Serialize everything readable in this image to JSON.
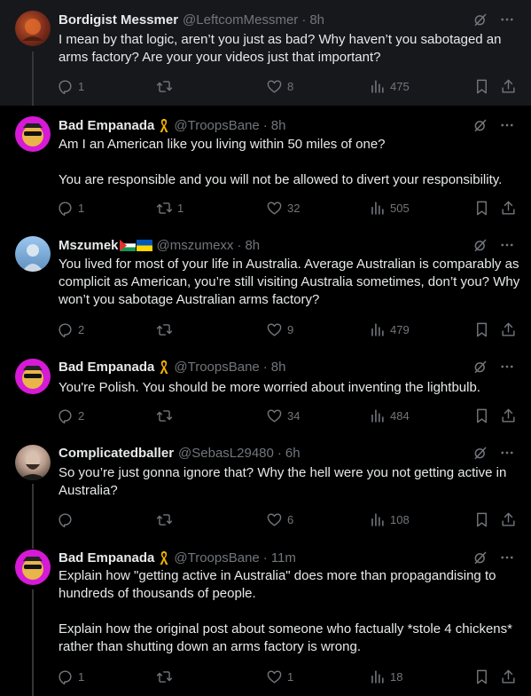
{
  "tweets": [
    {
      "name": "Bordigist Messmer",
      "handle": "@LeftcomMessmer",
      "time": "8h",
      "text": "I mean by that logic, aren’t you just as bad? Why haven’t you sabotaged an arms factory? Are your your videos just that important?",
      "replies": "1",
      "retweets": "",
      "likes": "8",
      "views": "475",
      "avatar": "orange-crest"
    },
    {
      "name": "Bad Empanada",
      "handle": "@TroopsBane",
      "time": "8h",
      "text": "Am I an American like you living within 50 miles of one?\n\nYou are responsible and you will not be allowed to divert your responsibility.",
      "replies": "1",
      "retweets": "1",
      "likes": "32",
      "views": "505",
      "avatar": "empanada"
    },
    {
      "name": "Mszumek",
      "handle": "@mszumexx",
      "time": "8h",
      "text": "You lived for most of your life in Australia. Average Australian is comparably as complicit as American, you’re still visiting Australia sometimes, don’t you? Why won’t you sabotage Australian arms factory?",
      "replies": "2",
      "retweets": "",
      "likes": "9",
      "views": "479",
      "avatar": "statue"
    },
    {
      "name": "Bad Empanada",
      "handle": "@TroopsBane",
      "time": "8h",
      "text": "You're Polish. You should be more worried about inventing the lightbulb.",
      "replies": "2",
      "retweets": "",
      "likes": "34",
      "views": "484",
      "avatar": "empanada"
    },
    {
      "name": "Complicatedballer",
      "handle": "@SebasL29480",
      "time": "6h",
      "text": "So you’re just gonna ignore that? Why the hell were you not getting active in Australia?",
      "replies": "",
      "retweets": "",
      "likes": "6",
      "views": "108",
      "avatar": "bearded-man"
    },
    {
      "name": "Bad Empanada",
      "handle": "@TroopsBane",
      "time": "11m",
      "text": "Explain how \"getting active in Australia\" does more than propagandising to hundreds of thousands of people.\n\nExplain how the original post about someone who factually *stole 4 chickens* rather than shutting down an arms factory is wrong.",
      "replies": "1",
      "retweets": "",
      "likes": "1",
      "views": "18",
      "avatar": "empanada"
    }
  ],
  "colors": {
    "background": "#000000",
    "highlight_background": "#16181c",
    "text": "#e7e9ea",
    "muted": "#71767b",
    "ribbon": "#f4b400",
    "avatar_pink": "#d61ad6"
  }
}
